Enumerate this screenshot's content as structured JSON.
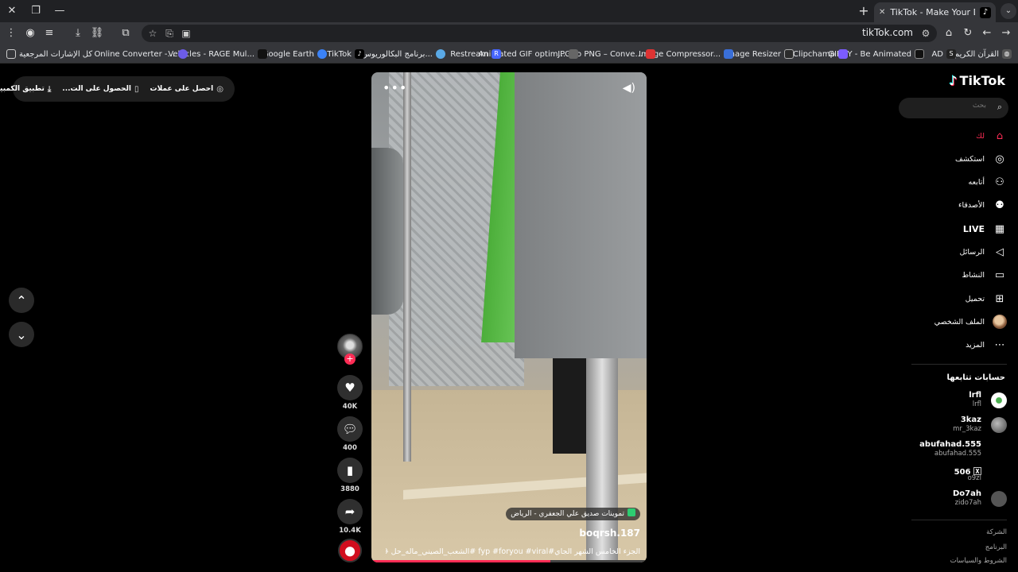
{
  "browser": {
    "tab_title": "TikTok - Make Your Day",
    "url": "tikTok.com",
    "bookmarks": [
      {
        "label": "القرآن الكريم",
        "icon": "S"
      },
      {
        "label": "AD",
        "icon": "S"
      },
      {
        "label": "GIPHY - Be Animated",
        "icon": "G"
      },
      {
        "label": "Clipchamp",
        "icon": "C"
      },
      {
        "label": "Image Resizer",
        "icon": "I"
      },
      {
        "label": "Image Compressor...",
        "icon": "I"
      },
      {
        "label": "JPG to PNG – Conve...",
        "icon": "J"
      },
      {
        "label": "Animated GIF optim...",
        "icon": "A"
      },
      {
        "label": "Restream",
        "icon": "R"
      },
      {
        "label": "برنامج البكالوريوس...",
        "icon": "B"
      },
      {
        "label": "TikTok",
        "icon": "T"
      },
      {
        "label": "Google Earth",
        "icon": "G"
      },
      {
        "label": "Vehicles - RAGE Mul...",
        "icon": "V"
      },
      {
        "label": "Online Converter -...",
        "icon": "O"
      },
      {
        "label": "كل الإشارات المرجعية",
        "icon": "F"
      }
    ]
  },
  "top_pill": {
    "coins": "احصل على عملات",
    "get_app": "الحصول على الت...",
    "desktop_app": "تطبيق الكمبيوتر"
  },
  "video": {
    "location": "تموينات صديق علي الجعفري - الرياض",
    "username": "boqrsh.187",
    "caption": "الجزء الخامس الشهر الجاي#fyp #foryou #viral #الشعب_الصيني_ماله_حل 😂😂",
    "progress": 0.65
  },
  "actions": {
    "likes": "40K",
    "comments": "400",
    "saves": "3880",
    "shares": "10.4K"
  },
  "sidebar": {
    "logo": "TikTok",
    "search_placeholder": "بحث",
    "nav": [
      {
        "label": "لك",
        "icon": "home-icon"
      },
      {
        "label": "استكشف",
        "icon": "compass-icon"
      },
      {
        "label": "أتابعه",
        "icon": "user-follow-icon"
      },
      {
        "label": "الأصدقاء",
        "icon": "friends-icon"
      },
      {
        "label": "LIVE",
        "icon": "live-icon"
      },
      {
        "label": "الرسائل",
        "icon": "send-icon"
      },
      {
        "label": "النشاط",
        "icon": "activity-icon"
      },
      {
        "label": "تحميل",
        "icon": "upload-icon"
      },
      {
        "label": "الملف الشخصي",
        "icon": "profile-avatar"
      },
      {
        "label": "المزيد",
        "icon": "more-icon"
      }
    ],
    "following_title": "حسابات تتابعها",
    "following": [
      {
        "name": "lrfl",
        "handle": "lrfl"
      },
      {
        "name": "3kaz",
        "handle": "mr_3kaz"
      },
      {
        "name": "abufahad.555",
        "handle": "abufahad.555"
      },
      {
        "name": "506 🅇",
        "handle": "o9zl"
      },
      {
        "name": "Do7ah",
        "handle": "zido7ah"
      }
    ],
    "footer": [
      "الشركة",
      "البرنامج",
      "الشروط والسياسات"
    ]
  }
}
